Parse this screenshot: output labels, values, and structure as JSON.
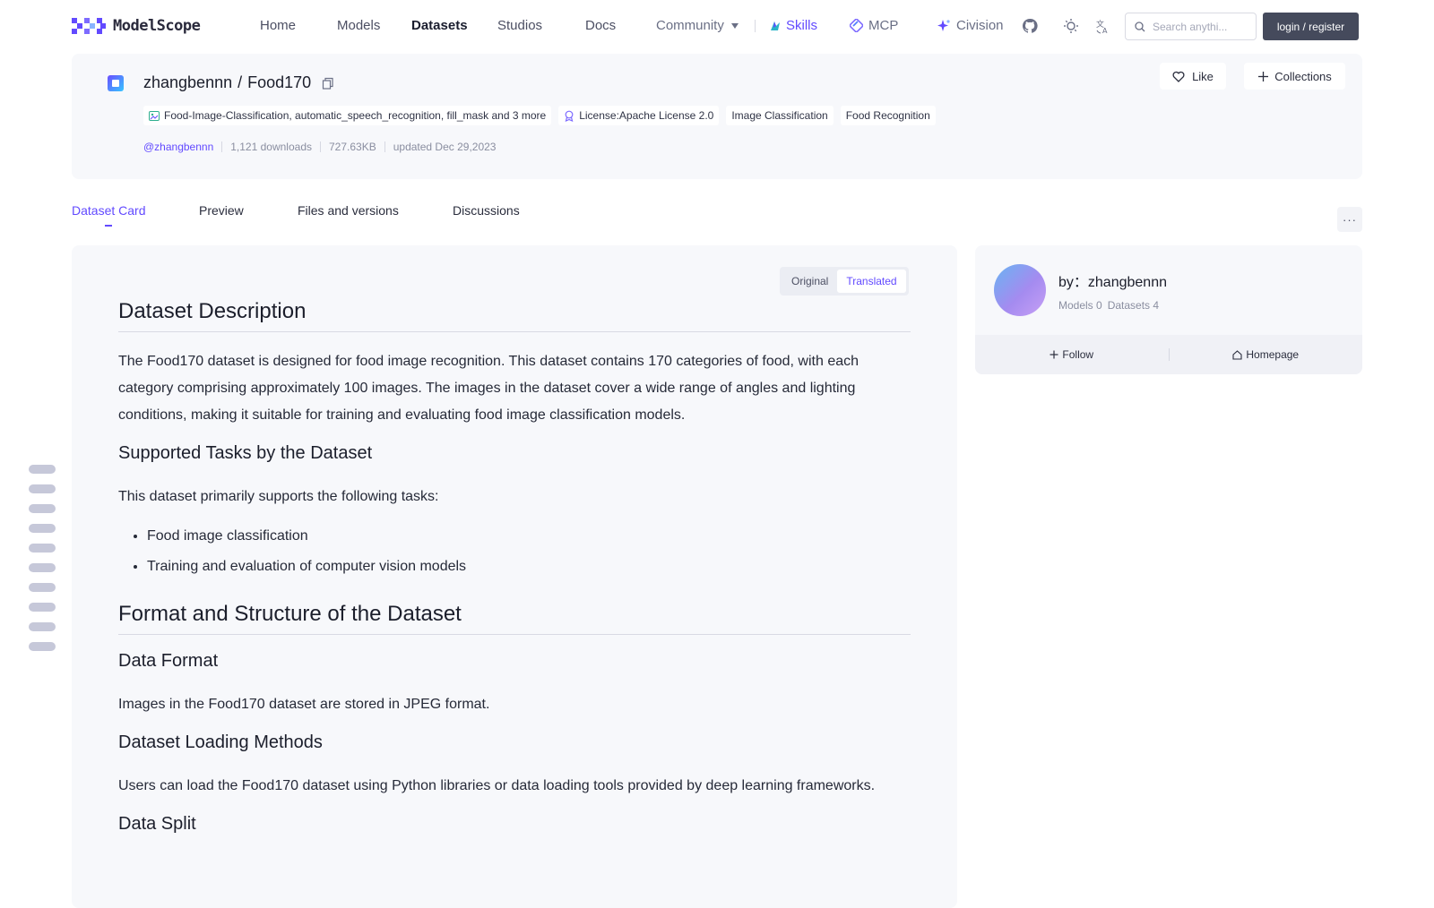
{
  "brand": {
    "name": "ModelScope",
    "accent": "#624aff"
  },
  "nav": {
    "home": "Home",
    "models": "Models",
    "datasets": "Datasets",
    "studios": "Studios",
    "docs": "Docs",
    "community": "Community",
    "skills": "Skills",
    "mcp": "MCP",
    "civision": "Civision",
    "search_placeholder": "Search anythi...",
    "login": "login / register"
  },
  "dataset": {
    "owner": "zhangbennn",
    "slash": "/",
    "name": "Food170",
    "like_label": "Like",
    "collections_label": "Collections",
    "tags": [
      {
        "label": "Food-Image-Classification, automatic_speech_recognition, fill_mask and 3 more",
        "icon": "task-icon"
      },
      {
        "label": "License:Apache License 2.0",
        "icon": "license-icon"
      },
      {
        "label": "Image Classification",
        "icon": ""
      },
      {
        "label": "Food Recognition",
        "icon": ""
      }
    ],
    "author_handle": "@zhangbennn",
    "downloads": "1,121 downloads",
    "size": "727.63KB",
    "updated": "updated Dec 29,2023"
  },
  "tabs": {
    "card": "Dataset Card",
    "preview": "Preview",
    "files": "Files and versions",
    "discussions": "Discussions",
    "more": "···"
  },
  "content": {
    "toggle_original": "Original",
    "toggle_translated": "Translated",
    "h_description": "Dataset Description",
    "p_description": "The Food170 dataset is designed for food image recognition. This dataset contains 170 categories of food, with each category comprising approximately 100 images. The images in the dataset cover a wide range of angles and lighting conditions, making it suitable for training and evaluating food image classification models.",
    "h_tasks": "Supported Tasks by the Dataset",
    "p_tasks": "This dataset primarily supports the following tasks:",
    "task_items": [
      "Food image classification",
      "Training and evaluation of computer vision models"
    ],
    "h_format": "Format and Structure of the Dataset",
    "h_data_format": "Data Format",
    "p_data_format": "Images in the Food170 dataset are stored in JPEG format.",
    "h_loading": "Dataset Loading Methods",
    "p_loading": "Users can load the Food170 dataset using Python libraries or data loading tools provided by deep learning frameworks.",
    "h_split": "Data Split"
  },
  "author_card": {
    "by_prefix": "by：",
    "name": "zhangbennn",
    "models": "Models 0",
    "datasets": "Datasets 4",
    "follow": "Follow",
    "homepage": "Homepage"
  }
}
